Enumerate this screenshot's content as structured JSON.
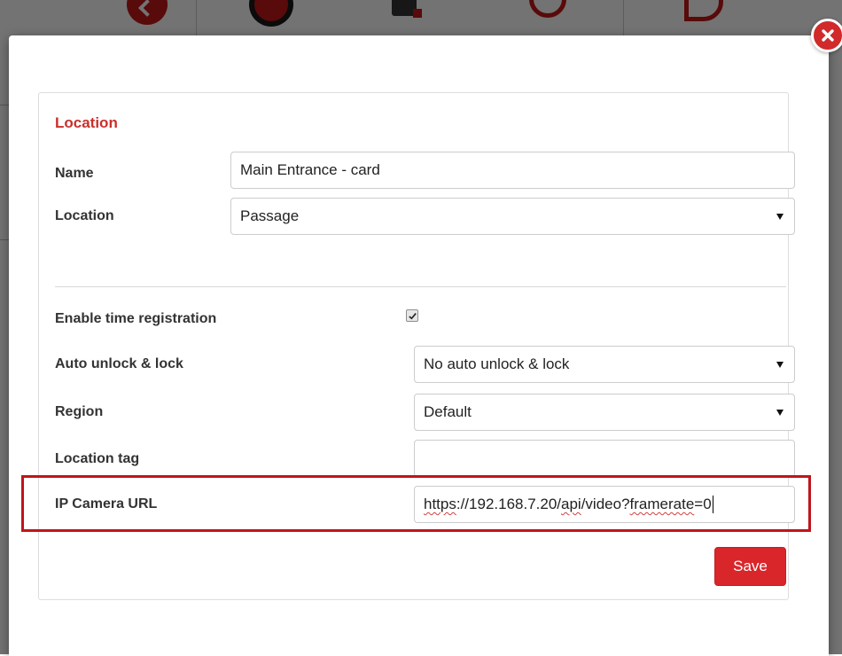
{
  "toolbar": {
    "icons": [
      "back-icon",
      "record-icon",
      "grid-icon",
      "search-icon",
      "heart-icon"
    ]
  },
  "modal": {
    "close_icon": "close-icon",
    "section_title": "Location",
    "name": {
      "label": "Name",
      "value": "Main Entrance - card"
    },
    "location": {
      "label": "Location",
      "selected": "Passage"
    },
    "time_registration": {
      "label": "Enable time registration",
      "checked": true
    },
    "auto_unlock": {
      "label": "Auto unlock & lock",
      "selected": "No auto unlock & lock"
    },
    "region": {
      "label": "Region",
      "selected": "Default"
    },
    "location_tag": {
      "label": "Location tag",
      "value": ""
    },
    "ip_camera": {
      "label": "IP Camera URL",
      "url_part1": "https",
      "url_part2": "://192.168.7.20/",
      "url_part3": "api",
      "url_part4": "/video?",
      "url_part5": "framerate",
      "url_part6": "=0"
    },
    "save_label": "Save"
  },
  "colors": {
    "accent": "#d9262b",
    "title": "#c9302c",
    "highlight": "#c0141c"
  }
}
